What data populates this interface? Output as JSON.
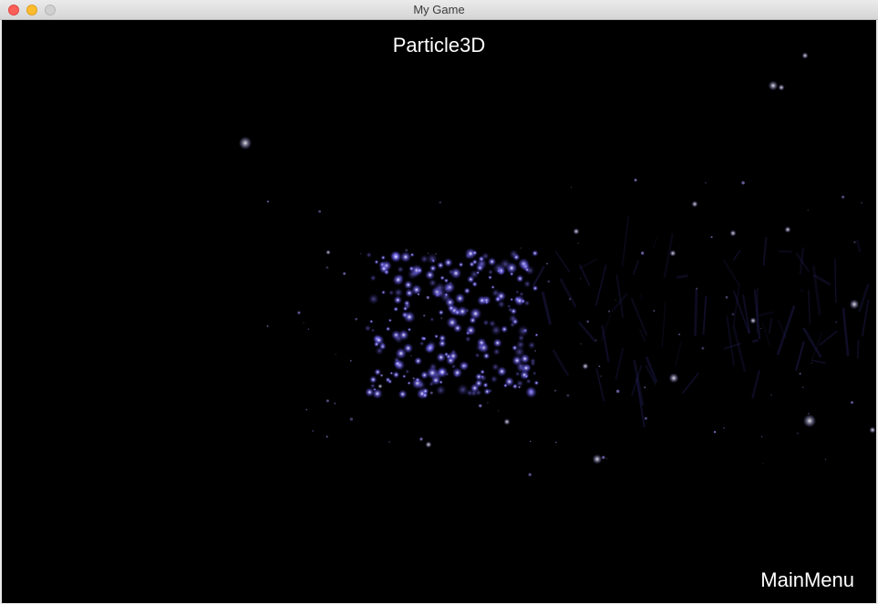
{
  "window": {
    "title": "My Game"
  },
  "scene": {
    "title": "Particle3D",
    "main_menu_label": "MainMenu"
  },
  "colors": {
    "background": "#000000",
    "particle_core": "#6a5cff",
    "particle_glow": "#3b33b0",
    "star": "#bfb8ff"
  }
}
